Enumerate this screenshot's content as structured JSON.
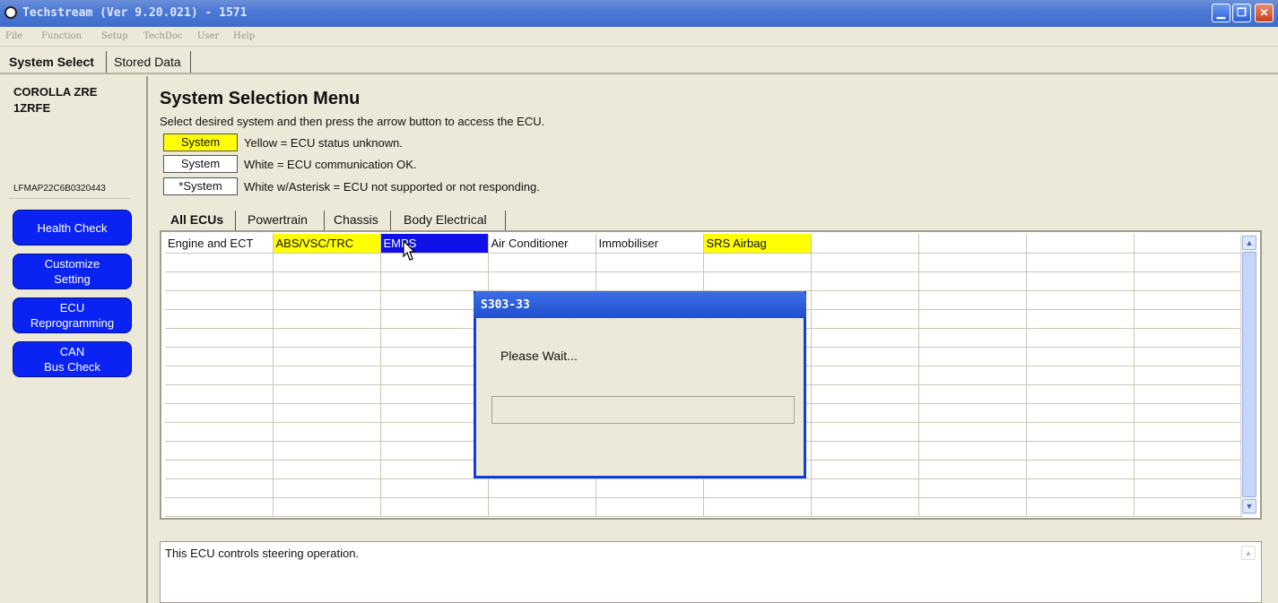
{
  "window": {
    "title": "Techstream (Ver 9.20.021) - 1571",
    "minimize_glyph": "▁",
    "maximize_glyph": "❐",
    "close_glyph": "✕"
  },
  "menu": [
    "File",
    "Function",
    "Setup",
    "TechDoc",
    "User",
    "Help"
  ],
  "top_tabs": [
    {
      "label": "System Select"
    },
    {
      "label": "Stored Data"
    }
  ],
  "sidebar": {
    "vehicle_line1": "COROLLA ZRE",
    "vehicle_line2": "1ZRFE",
    "vin": "LFMAP22C6B0320443",
    "buttons": [
      {
        "label": "Health Check"
      },
      {
        "label": "Customize\nSetting"
      },
      {
        "label": "ECU\nReprogramming"
      },
      {
        "label": "CAN\nBus Check"
      }
    ]
  },
  "main": {
    "title": "System Selection Menu",
    "instruction": "Select desired system and then press the arrow button to access the ECU.",
    "legend": [
      {
        "box": "System",
        "text": "Yellow = ECU status unknown.",
        "color": "#ffff00"
      },
      {
        "box": "System",
        "text": "White = ECU communication OK.",
        "color": "#ffffff"
      },
      {
        "box": "*System",
        "text": "White w/Asterisk = ECU not supported or not responding.",
        "color": "#ffffff"
      }
    ],
    "ecu_tabs": [
      "All ECUs",
      "Powertrain",
      "Chassis",
      "Body Electrical"
    ],
    "grid_row1": [
      {
        "label": "Engine and ECT",
        "state": "white"
      },
      {
        "label": "ABS/VSC/TRC",
        "state": "yellow"
      },
      {
        "label": "EMPS",
        "state": "selected"
      },
      {
        "label": "Air Conditioner",
        "state": "white"
      },
      {
        "label": "Immobiliser",
        "state": "white"
      },
      {
        "label": "SRS Airbag",
        "state": "yellow"
      }
    ],
    "description": "This ECU controls steering operation."
  },
  "dialog": {
    "title": "S303-33",
    "message": "Please Wait..."
  },
  "scroll": {
    "up": "▲",
    "down": "▼"
  },
  "colors": {
    "title_bar": "#4d79d6",
    "sidebar_button": "#0a23f2",
    "unknown_status": "#ffff00",
    "selected_cell": "#1010e8"
  }
}
